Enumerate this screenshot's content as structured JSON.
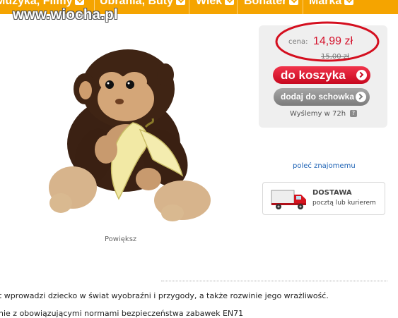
{
  "nav": {
    "items": [
      {
        "label": "Muzyka, Filmy"
      },
      {
        "label": "Ubrania, Buty"
      },
      {
        "label": "Wiek"
      },
      {
        "label": "Bohater"
      },
      {
        "label": "Marka"
      }
    ]
  },
  "watermark": "www.wiocha.pl",
  "product": {
    "zoom_label": "Powiększ"
  },
  "price": {
    "label": "cena:",
    "current": "14,99 zł",
    "old": "15,00 zł"
  },
  "buttons": {
    "add_to_cart": "do koszyka",
    "add_to_wishlist": "dodaj do schowka"
  },
  "shipping_note": "Wyślemy w 72h",
  "help_icon": "?",
  "recommend_label": "poleć znajomemu",
  "delivery": {
    "title": "DOSTAWA",
    "subtitle": "pocztą lub kurierem"
  },
  "description": {
    "line1": "t wprowadzi dziecko w świat wyobraźni i przygody, a także rozwinie jego wrażliwość.",
    "line2": "nie z obowiązującymi normami bezpieczeństwa zabawek EN71"
  },
  "colors": {
    "nav_bg": "#f5a400",
    "price_red": "#d4112b",
    "cart_button": "#d41a30",
    "highlight_circle": "#d40f1f",
    "link_blue": "#1e63b5"
  }
}
